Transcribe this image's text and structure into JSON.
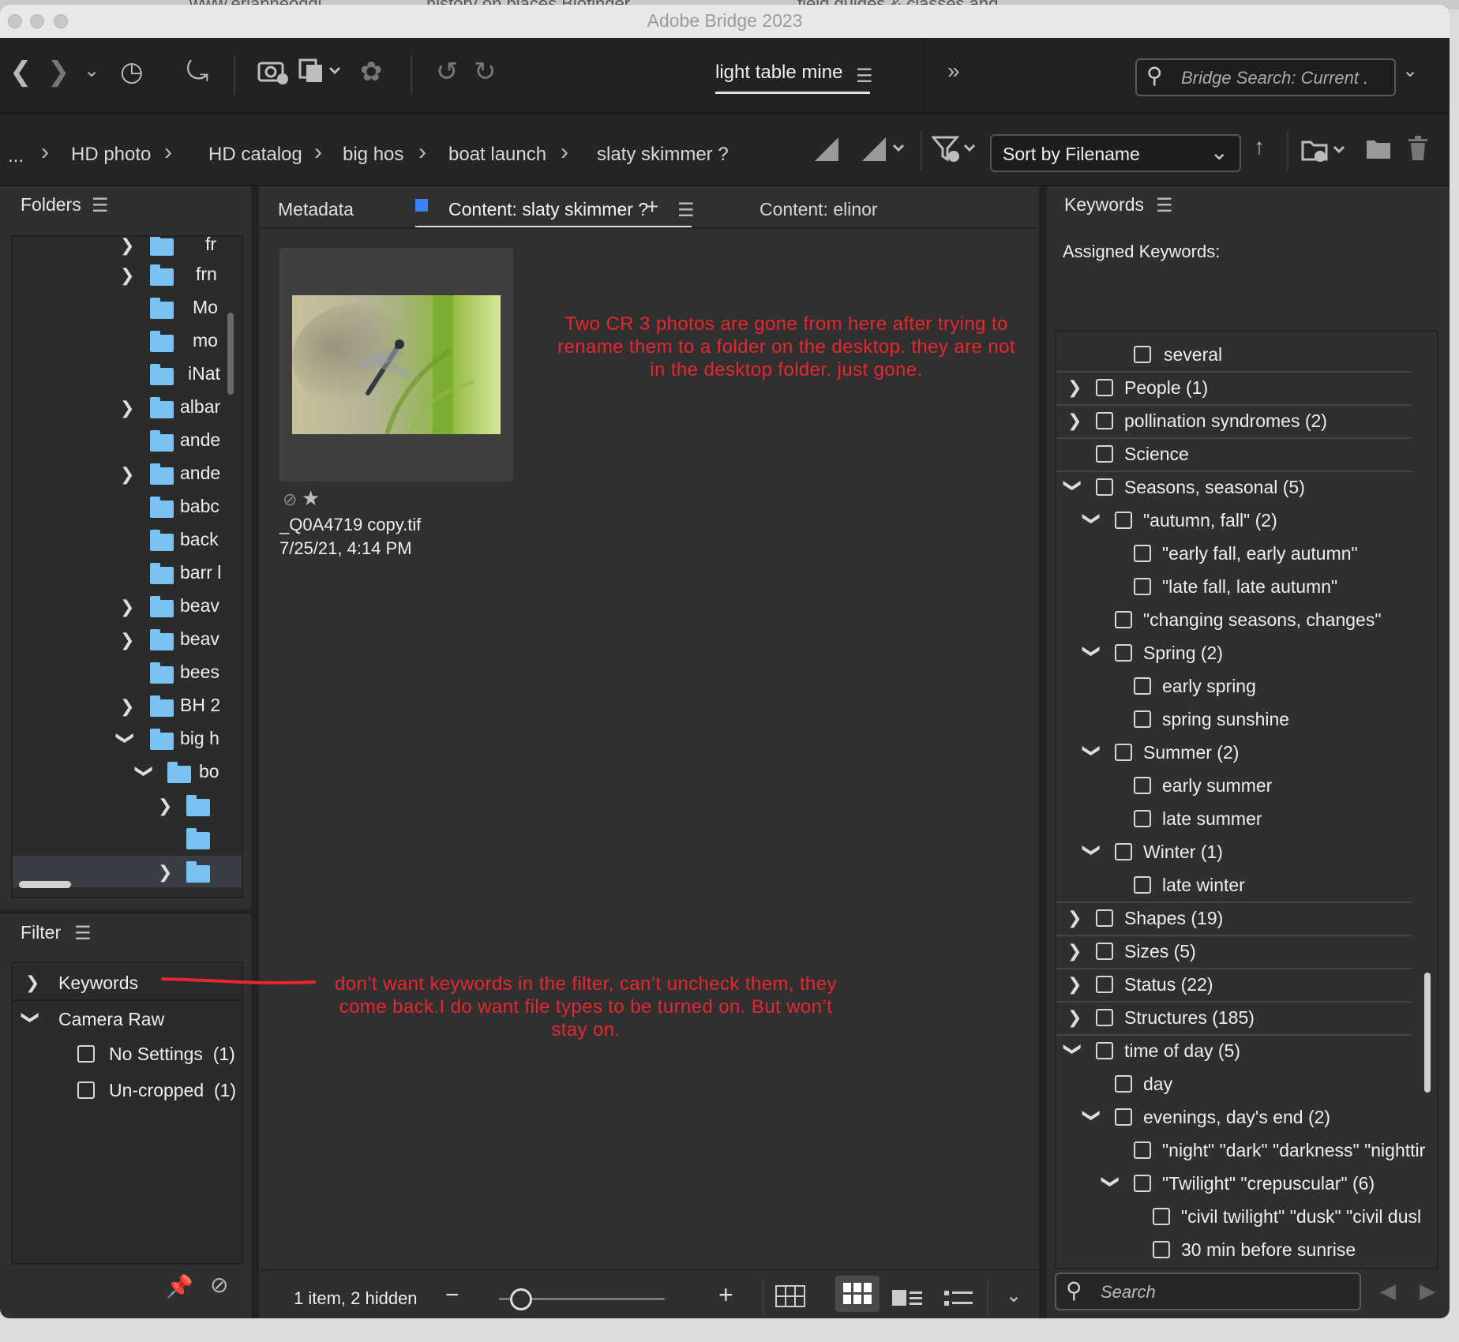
{
  "window": {
    "title": "Adobe Bridge 2023"
  },
  "toolbar": {
    "workspace": "light table mine",
    "search_placeholder": "Bridge Search: Current ."
  },
  "path": {
    "ellipsis": "...",
    "crumbs": [
      "HD photo",
      "HD catalog",
      "big hos",
      "boat launch",
      "slaty skimmer ?"
    ],
    "sort_label": "Sort by Filename"
  },
  "folders": {
    "header": "Folders",
    "rows": [
      "fr",
      "frn",
      "Mo",
      "mo",
      "iNat",
      "albar",
      "ande",
      "ande",
      "babc",
      "back",
      "barr l",
      "beav",
      "beav",
      "bees",
      "BH 2",
      "big h",
      "bo"
    ]
  },
  "filter": {
    "header": "Filter",
    "keywords": "Keywords",
    "camera_raw": "Camera Raw",
    "items": [
      {
        "label": "No Settings",
        "count": "(1)"
      },
      {
        "label": "Un-cropped",
        "count": "(1)"
      }
    ]
  },
  "tabs": {
    "metadata": "Metadata",
    "content_active": "Content: slaty skimmer ?",
    "content_other": "Content: elinor"
  },
  "content": {
    "filename": "_Q0A4719 copy.tif",
    "date": "7/25/21, 4:14 PM",
    "status": "1 item, 2 hidden",
    "note1": "Two CR 3 photos are gone from here after trying to rename them to a folder on the desktop. they are not in the desktop folder. just gone.",
    "note2": "don’t want keywords in the filter, can’t uncheck them, they come back.I do want file types to be turned on. But won’t stay on."
  },
  "keywords": {
    "header": "Keywords",
    "assigned": "Assigned Keywords:",
    "search_placeholder": "Search",
    "rows": [
      "several",
      "People  (1)",
      "pollination syndromes  (2)",
      "Science",
      "Seasons, seasonal  (5)",
      "\"autumn, fall\"  (2)",
      "\"early fall, early autumn\"",
      "\"late fall, late autumn\"",
      "\"changing seasons, changes\"",
      "Spring  (2)",
      "early spring",
      "spring sunshine",
      "Summer  (2)",
      "early summer",
      "late summer",
      "Winter  (1)",
      "late winter",
      "Shapes  (19)",
      "Sizes  (5)",
      "Status  (22)",
      "Structures  (185)",
      "time of day  (5)",
      "day",
      "evenings, day's end  (2)",
      "\"night\" \"dark\" \"darkness\" \"nighttir",
      "\"Twilight\" \"crepuscular\"  (6)",
      "\"civil twilight\" \"dusk\" \"civil dusl",
      "30 min before sunrise"
    ]
  },
  "colors": {
    "annotation": "#e8262f",
    "folder": "#78c3f2",
    "tab_marker": "#3b82f6",
    "panel_bg": "#2f2f2f"
  }
}
